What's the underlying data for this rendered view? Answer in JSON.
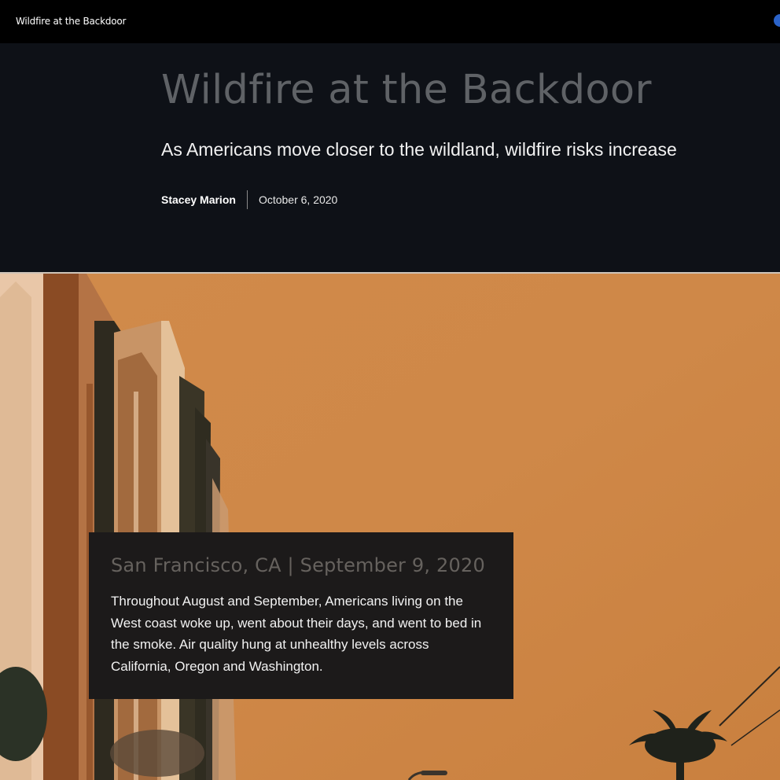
{
  "topbar": {
    "app_title": "Wildfire at the Backdoor"
  },
  "hero": {
    "title": "Wildfire at the Backdoor",
    "subtitle": "As Americans move closer to the wildland, wildfire risks increase",
    "author": "Stacey Marion",
    "date": "October 6, 2020"
  },
  "photo": {
    "subject": "smoke-filled orange sky over buildings"
  },
  "caption": {
    "heading": "San Francisco, CA | September 9, 2020",
    "body": "Throughout August and September, Americans living on the West coast woke up, went about their days, and went to bed in the smoke. Air quality hung at unhealthy levels across California, Oregon and Washington."
  },
  "colors": {
    "topbar": "#000000",
    "hero_background": "#0e1117",
    "title": "#5f6266",
    "sky": "#cd8647",
    "caption_background": "#1c1a1a"
  }
}
